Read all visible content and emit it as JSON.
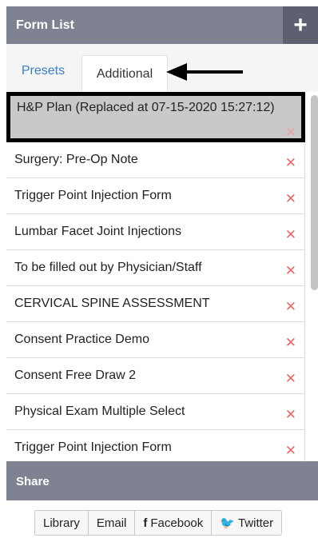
{
  "header": {
    "title": "Form List",
    "add_icon": "+"
  },
  "tabs": [
    {
      "label": "Presets",
      "active": false
    },
    {
      "label": "Additional",
      "active": true
    }
  ],
  "forms": [
    {
      "label": "H&P Plan (Replaced at 07-15-2020 15:27:12)",
      "selected": true
    },
    {
      "label": "Surgery: Pre-Op Note"
    },
    {
      "label": "Trigger Point Injection Form"
    },
    {
      "label": "Lumbar Facet Joint Injections"
    },
    {
      "label": "To be filled out by Physician/Staff"
    },
    {
      "label": "CERVICAL SPINE ASSESSMENT"
    },
    {
      "label": "Consent Practice Demo"
    },
    {
      "label": "Consent Free Draw 2"
    },
    {
      "label": "Physical Exam Multiple Select"
    },
    {
      "label": "Trigger Point Injection Form"
    }
  ],
  "delete_glyph": "✕",
  "share": {
    "title": "Share",
    "buttons": [
      {
        "label": "Library",
        "icon": ""
      },
      {
        "label": "Email",
        "icon": ""
      },
      {
        "label": "Facebook",
        "icon": "f"
      },
      {
        "label": "Twitter",
        "icon": "🐦"
      }
    ]
  },
  "colors": {
    "header_bg": "#7f8291",
    "add_button_bg": "#5e6070",
    "delete_red": "#e36a6a",
    "tab_link_blue": "#3a7fc1",
    "selected_row_bg": "#c9c9c9"
  }
}
